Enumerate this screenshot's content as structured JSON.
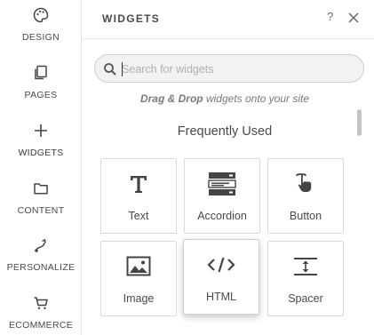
{
  "nav": {
    "items": [
      {
        "label": "DESIGN",
        "icon": "palette-icon"
      },
      {
        "label": "PAGES",
        "icon": "pages-icon"
      },
      {
        "label": "WIDGETS",
        "icon": "plus-icon"
      },
      {
        "label": "CONTENT",
        "icon": "folder-icon"
      },
      {
        "label": "PERSONALIZE",
        "icon": "personalize-icon"
      },
      {
        "label": "ECOMMERCE",
        "icon": "cart-icon"
      }
    ]
  },
  "panel": {
    "title": "WIDGETS",
    "help_label": "?",
    "search": {
      "placeholder": "Search for widgets",
      "value": ""
    },
    "hint": {
      "bold": "Drag & Drop",
      "rest": " widgets onto your site"
    },
    "section_title": "Frequently Used",
    "widgets": [
      {
        "label": "Text",
        "icon": "text-icon"
      },
      {
        "label": "Accordion",
        "icon": "accordion-icon"
      },
      {
        "label": "Button",
        "icon": "button-click-icon"
      },
      {
        "label": "Image",
        "icon": "image-icon"
      },
      {
        "label": "HTML",
        "icon": "code-icon"
      },
      {
        "label": "Spacer",
        "icon": "spacer-icon"
      }
    ]
  },
  "colors": {
    "icon": "#444444",
    "border": "#d9d9d9",
    "search_bg": "#f2f2f2"
  }
}
